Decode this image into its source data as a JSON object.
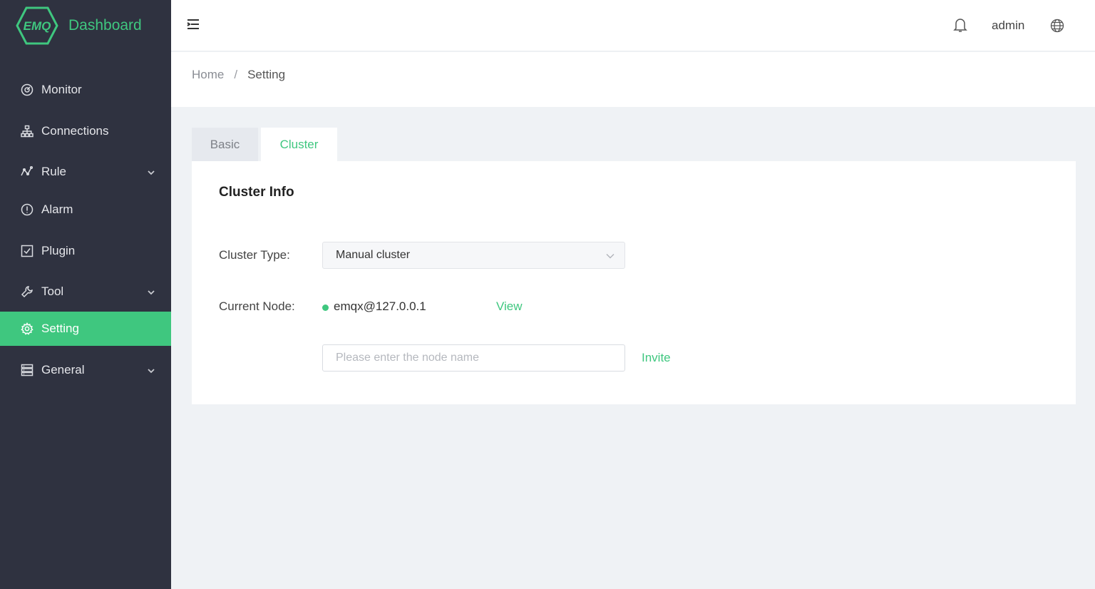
{
  "app": {
    "logo_text": "EMQ",
    "title": "Dashboard"
  },
  "sidebar": {
    "items": [
      {
        "label": "Monitor",
        "icon": "monitor-icon",
        "expandable": false,
        "active": false
      },
      {
        "label": "Connections",
        "icon": "connections-icon",
        "expandable": false,
        "active": false
      },
      {
        "label": "Rule",
        "icon": "rule-icon",
        "expandable": true,
        "active": false
      },
      {
        "label": "Alarm",
        "icon": "alarm-icon",
        "expandable": false,
        "active": false
      },
      {
        "label": "Plugin",
        "icon": "plugin-icon",
        "expandable": false,
        "active": false
      },
      {
        "label": "Tool",
        "icon": "tool-icon",
        "expandable": true,
        "active": false
      },
      {
        "label": "Setting",
        "icon": "gear-icon",
        "expandable": false,
        "active": true
      },
      {
        "label": "General",
        "icon": "general-icon",
        "expandable": true,
        "active": false
      }
    ]
  },
  "header": {
    "user": "admin",
    "icons": [
      "hamburger-icon",
      "bell-icon",
      "globe-icon"
    ]
  },
  "breadcrumb": {
    "home": "Home",
    "separator": "/",
    "current": "Setting"
  },
  "tabs": [
    {
      "label": "Basic",
      "active": false
    },
    {
      "label": "Cluster",
      "active": true
    }
  ],
  "cluster": {
    "title": "Cluster Info",
    "type_label": "Cluster Type:",
    "type_value": "Manual cluster",
    "node_label": "Current Node:",
    "node_value": "emqx@127.0.0.1",
    "node_status": "running",
    "view_label": "View",
    "invite_placeholder": "Please enter the node name",
    "invite_label": "Invite"
  },
  "colors": {
    "accent": "#3fc77f",
    "sidebar_bg": "#2f3240",
    "content_bg": "#eff2f5"
  }
}
